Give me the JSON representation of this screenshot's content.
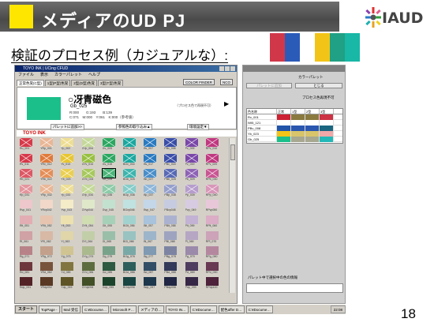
{
  "slide": {
    "title": "メディアのUD PJ",
    "subtitle": "検証のプロセス例（カジュアルな）:",
    "page_number": "18",
    "logo_text": "IAUD",
    "accent_swatches": [
      "#d0384a",
      "#2a5bb8",
      "#ffffff",
      "#f2c417",
      "#20a084",
      "#18b7a6"
    ]
  },
  "app": {
    "title": "TOYO INK | UCing CFUD",
    "menu": [
      "ファイル",
      "表示",
      "カラーパレット",
      "ヘルプ"
    ],
    "tabs": [
      "正常色覚(C型)",
      "1型(P型)色覚",
      "2型(D型)色覚",
      "3型(T型)色覚"
    ],
    "color_finder_label": "COLOR FINDER",
    "nco_label": "NCO",
    "selected": {
      "name": "○冴青磁色",
      "code": "Gb_025",
      "rgb": "R:000　　G:193　　B:139",
      "cmyk": "C:071　M:000　Y:061　K:000（参考値）",
      "note": "（プロセス色で再現不可）",
      "chip_color": "#1bbf8a"
    },
    "buttons": {
      "add_to_palette": "パレットに追加>>",
      "reference_color": "参照色の取り込み▲",
      "environment_settings": "環境設定▼"
    },
    "brand": "TOYO INK",
    "grid_rows": [
      [
        "Ru_001",
        "YRp_001",
        "Yp_002",
        "GYp_004",
        "Gv_005",
        "BGv_006",
        "Bv_007",
        "PBv_008",
        "Pv_009",
        "RPv_010"
      ],
      [
        "Rv_011",
        "YRv_012",
        "Yv_013",
        "GYv_014",
        "Gv_015",
        "BGv_016",
        "Bv_017",
        "PBv_018",
        "Pv_019",
        "RPv_020"
      ],
      [
        "Rb_021",
        "YRb_022",
        "Yb_023",
        "GYb_024",
        "Gb_025",
        "BGb_026",
        "Bb_027",
        "PBb_028",
        "Pb_029",
        "RPb_030"
      ],
      [
        "Rp_031",
        "YRp_032",
        "Yp_033",
        "GYp_034",
        "Gp_035",
        "BGp_036",
        "Bp_037",
        "PBp_038",
        "Pp_039",
        "RPp_040"
      ],
      [
        "Rvp_041",
        "YRvp042",
        "Yvp_043",
        "GYvp044",
        "Gvp_045",
        "BGvp046",
        "Bvp_047",
        "PBvp048",
        "Pvp_049",
        "RPvp050"
      ],
      [
        "Rlt_051",
        "YRlt_052",
        "Ylt_053",
        "GYlt_054",
        "Glt_055",
        "BGlt_056",
        "Blt_057",
        "PBlt_058",
        "Plt_059",
        "RPlt_060"
      ],
      [
        "Rl_061",
        "YRl_062",
        "Yl_063",
        "GYl_064",
        "Gl_065",
        "BGl_066",
        "Bl_067",
        "PBl_068",
        "Pl_069",
        "RPl_070"
      ],
      [
        "Rg_071",
        "YRg_072",
        "Yg_073",
        "GYg_074",
        "Gg_075",
        "BGg_076",
        "Bg_077",
        "PBg_078",
        "Pg_079",
        "RPg_080"
      ],
      [
        "Rd_081",
        "YRd_082",
        "Yd_083",
        "GYd_084",
        "Gd_085",
        "BGd_086",
        "Bd_087",
        "PBd_088",
        "Pd_089",
        "RPd_090"
      ],
      [
        "Rdp_091",
        "YRdp092",
        "Ydp_093",
        "GYdp094",
        "Gdp_095",
        "BGdp096",
        "Bdp_097",
        "PBdp098",
        "Pdp_099",
        "RPdp100"
      ]
    ]
  },
  "side_panel": {
    "title": "カラーパレット",
    "btn_palette_add": "パレットに追加",
    "btn_close": "とじる",
    "process_label": "プロセス色再現不可",
    "list_headers": [
      "色名称",
      "正常",
      "1型",
      "2型",
      "3型"
    ],
    "list_rows": [
      {
        "name": "Rv_001",
        "swatches": [
          "#cc2233",
          "#8a7a40",
          "#8a7a40",
          "#cc3344"
        ]
      },
      {
        "name": "N95_121",
        "swatches": [
          "#ffffff",
          "#ffffff",
          "#ffffff",
          "#ffffff"
        ]
      },
      {
        "name": "PBv_008",
        "swatches": [
          "#2255aa",
          "#2a56b0",
          "#2a56b0",
          "#1a6680"
        ]
      },
      {
        "name": "Yb_023",
        "swatches": [
          "#f2c417",
          "#d8c46a",
          "#d8c46a",
          "#f0a8a8"
        ]
      },
      {
        "name": "Gb_025",
        "swatches": [
          "#1bbf8a",
          "#a8a890",
          "#a8a890",
          "#22b8b8"
        ]
      }
    ],
    "comment_label": "パレット中で選択中の色の情報"
  },
  "taskbar": {
    "start": "スタート",
    "items": [
      "TopPage -",
      "Mail 受信",
      "C:¥Docume…",
      "Microsoft P…",
      "メディアの…",
      "TOYO IN…",
      "C:¥Docume…",
      "配色affer D…",
      "C:¥Docume…"
    ],
    "clock": "22:08"
  }
}
